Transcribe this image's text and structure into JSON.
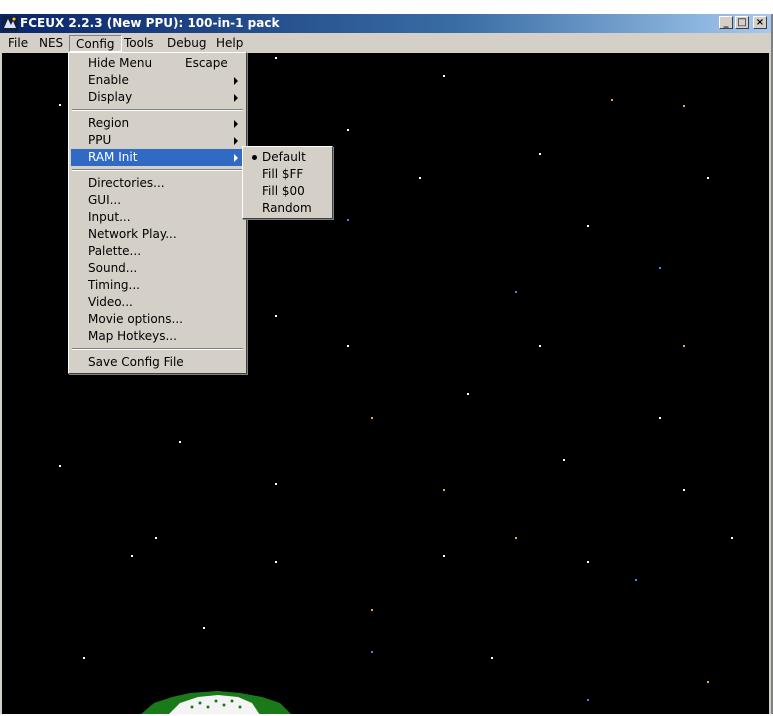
{
  "window": {
    "title": "FCEUX 2.2.3 (New PPU): 100-in-1 pack"
  },
  "caption_buttons": {
    "minimize": "_",
    "maximize": "□",
    "close": "×"
  },
  "menubar": {
    "items": [
      {
        "label": "File"
      },
      {
        "label": "NES"
      },
      {
        "label": "Config",
        "open": true
      },
      {
        "label": "Tools"
      },
      {
        "label": "Debug"
      },
      {
        "label": "Help"
      }
    ]
  },
  "config_menu": {
    "hide_menu": {
      "label": "Hide Menu",
      "accelerator": "Escape"
    },
    "enable": "Enable",
    "display": "Display",
    "region": "Region",
    "ppu": "PPU",
    "ram_init": "RAM Init",
    "directories": "Directories...",
    "gui": "GUI...",
    "input": "Input...",
    "network_play": "Network Play...",
    "palette": "Palette...",
    "sound": "Sound...",
    "timing": "Timing...",
    "video": "Video...",
    "movie_options": "Movie options...",
    "map_hotkeys": "Map Hotkeys...",
    "save_config": "Save Config File"
  },
  "ram_init_menu": {
    "items": [
      {
        "label": "Default",
        "checked": true
      },
      {
        "label": "Fill $FF"
      },
      {
        "label": "Fill $00"
      },
      {
        "label": "Random"
      }
    ]
  },
  "colors": {
    "titlebar_start": "#0a246a",
    "titlebar_end": "#a6caf0",
    "menu_face": "#d4d0c8",
    "menu_highlight": "#316ac5",
    "game_background": "#000000",
    "star_white": "#ffffff",
    "star_orange": "#f0a050",
    "star_blue": "#5090e0",
    "star_purple": "#a060e0",
    "ufo_green": "#1a7a1a"
  },
  "icons": {
    "app": "fceux-app-icon",
    "submenu": "submenu-arrow-icon",
    "radio": "radio-bullet-icon"
  }
}
